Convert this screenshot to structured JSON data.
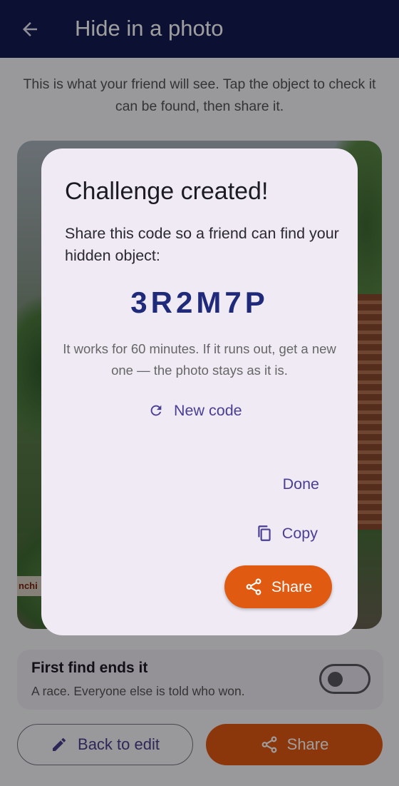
{
  "appbar": {
    "title": "Hide in a photo",
    "back_icon": "arrow-back-icon"
  },
  "intro": "This is what your friend will see. Tap the object to check it can be found, then share it.",
  "photo": {
    "sign_text": "nchi"
  },
  "toggle": {
    "title": "First find ends it",
    "subtitle": "A race. Everyone else is told who won.",
    "on": false
  },
  "buttons": {
    "back_to_edit": "Back to edit",
    "share": "Share"
  },
  "dialog": {
    "title": "Challenge created!",
    "body": "Share this code so a friend can find your hidden object:",
    "code": "3R2M7P",
    "note": "It works for 60 minutes. If it runs out, get a new one — the photo stays as it is.",
    "new_code": "New code",
    "done": "Done",
    "copy": "Copy",
    "share": "Share"
  },
  "colors": {
    "appbar": "#141c54",
    "accent": "#e05a12",
    "primary_text": "#4b3f93",
    "code": "#1f2a7a"
  }
}
